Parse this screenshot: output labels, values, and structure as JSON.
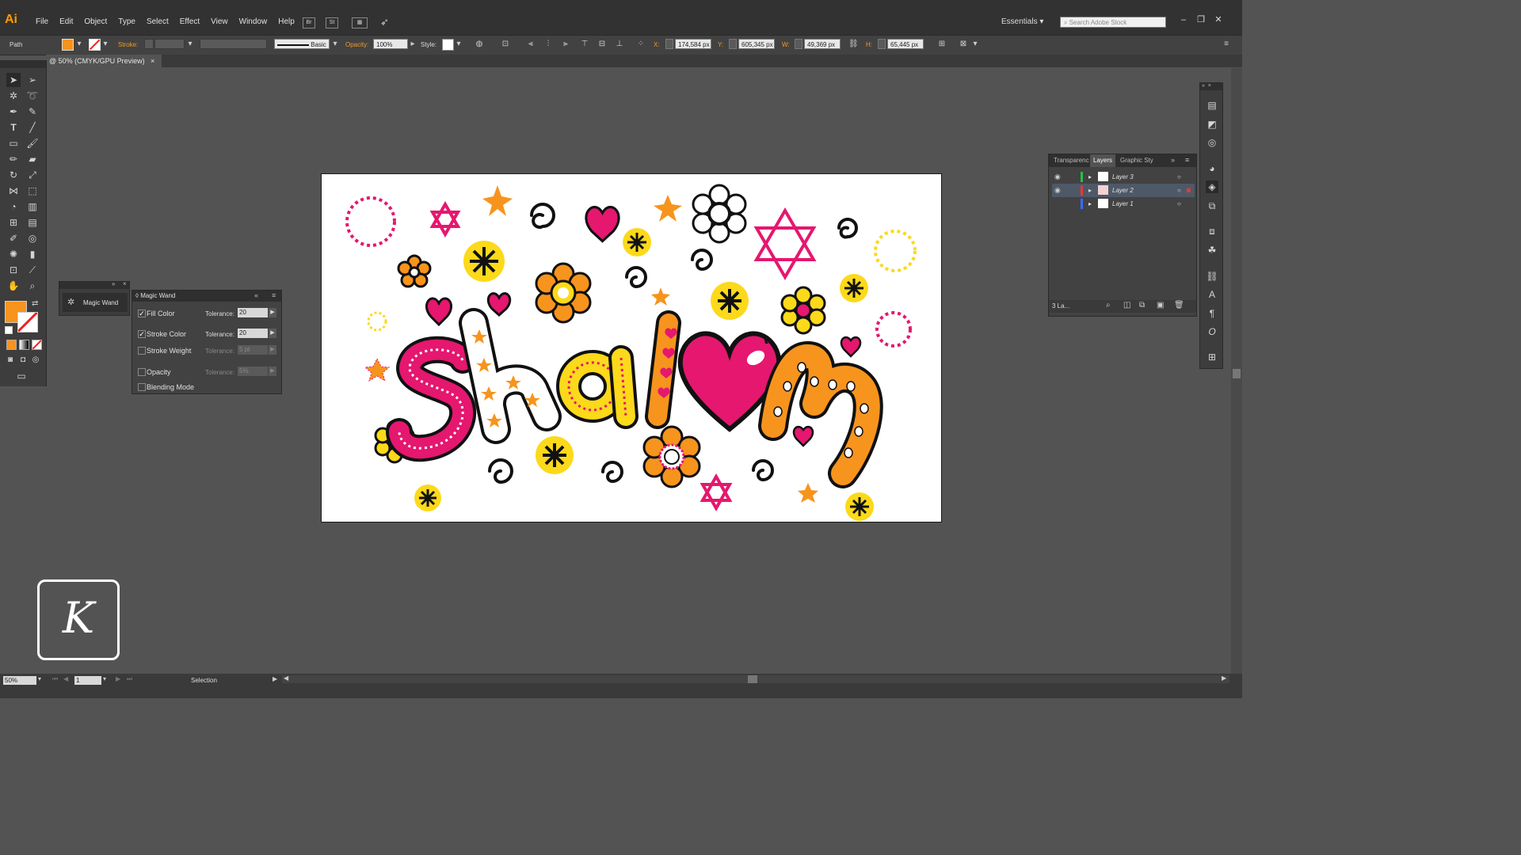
{
  "app": {
    "logo": "Ai",
    "menus": [
      "File",
      "Edit",
      "Object",
      "Type",
      "Select",
      "Effect",
      "View",
      "Window",
      "Help"
    ],
    "menu_icons": [
      "Br",
      "St"
    ],
    "workspace": "Essentials",
    "stock_search_placeholder": "Search Adobe Stock"
  },
  "control_bar": {
    "object_type": "Path",
    "stroke_label": "Stroke:",
    "stroke_style": "Basic",
    "opacity_label": "Opacity:",
    "opacity_value": "100%",
    "style_label": "Style:",
    "x_label": "X:",
    "x_value": "174,584 px",
    "y_label": "Y:",
    "y_value": "605,345 px",
    "w_label": "W:",
    "w_value": "49,369 px",
    "h_label": "H:",
    "h_value": "65,445 px",
    "fill_color": "#f7941d"
  },
  "document_tab": {
    "title": "@ 50% (CMYK/GPU Preview)",
    "close": "×"
  },
  "magic_wand": {
    "stub_label": "Magic Wand",
    "panel_title": "Magic Wand",
    "rows": [
      {
        "label": "Fill Color",
        "checked": "✓",
        "tol_label": "Tolerance:",
        "tol_value": "20"
      },
      {
        "label": "Stroke Color",
        "checked": "✓",
        "tol_label": "Tolerance:",
        "tol_value": "20"
      },
      {
        "label": "Stroke Weight",
        "checked": "",
        "tol_label": "Tolerance:",
        "tol_value": "5 pt"
      },
      {
        "label": "Opacity",
        "checked": "",
        "tol_label": "Tolerance:",
        "tol_value": "5%"
      },
      {
        "label": "Blending Mode",
        "checked": ""
      }
    ]
  },
  "layers_panel": {
    "tabs": [
      "Transparenc",
      "Layers",
      "Graphic Sty"
    ],
    "layers": [
      {
        "name": "Layer 3",
        "color": "#22c04a"
      },
      {
        "name": "Layer 2",
        "color": "#e53935"
      },
      {
        "name": "Layer 1",
        "color": "#3a6bff"
      }
    ],
    "footer": "3 La..."
  },
  "artwork": {
    "word": "Shalom",
    "letters": [
      "S",
      "h",
      "a",
      "l",
      "m"
    ],
    "colors": {
      "pink": "#e5176f",
      "orange": "#f7941d",
      "yellow": "#fcd91a",
      "black": "#111111"
    }
  },
  "status_bar": {
    "zoom": "50%",
    "artboard_num": "1",
    "tool_name": "Selection"
  },
  "watermark": "K"
}
